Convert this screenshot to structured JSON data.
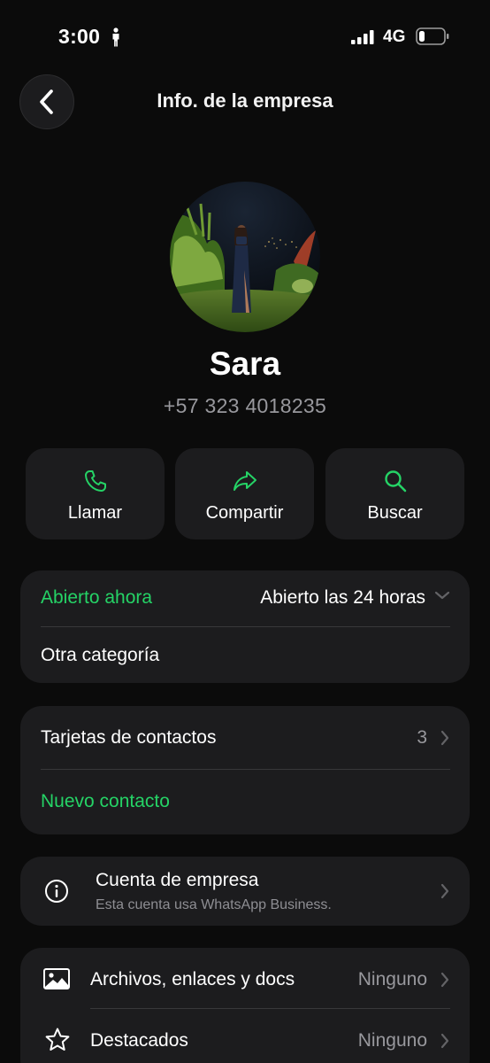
{
  "status_bar": {
    "time": "3:00",
    "network": "4G",
    "icons": [
      "person-walking-icon",
      "signal-bars-icon",
      "battery-low-icon"
    ]
  },
  "nav": {
    "title": "Info. de la empresa",
    "back_icon": "chevron-left-icon"
  },
  "profile": {
    "name": "Sara",
    "phone": "+57 323 4018235"
  },
  "actions": [
    {
      "label": "Llamar",
      "icon": "phone-icon"
    },
    {
      "label": "Compartir",
      "icon": "share-arrow-icon"
    },
    {
      "label": "Buscar",
      "icon": "search-icon"
    }
  ],
  "hours_card": {
    "status": "Abierto ahora",
    "hours": "Abierto las 24 horas",
    "category": "Otra categoría"
  },
  "contacts_card": {
    "label": "Tarjetas de contactos",
    "count": "3",
    "new_contact": "Nuevo contacto"
  },
  "business_card": {
    "title": "Cuenta de empresa",
    "subtitle": "Esta cuenta usa WhatsApp Business.",
    "icon": "info-circle-icon"
  },
  "media_card": {
    "items": [
      {
        "label": "Archivos, enlaces y docs",
        "value": "Ninguno",
        "icon": "image-icon"
      },
      {
        "label": "Destacados",
        "value": "Ninguno",
        "icon": "star-icon"
      }
    ]
  },
  "colors": {
    "accent": "#25d366",
    "background": "#0b0b0b",
    "card": "#1c1c1e",
    "secondary_text": "#98989d"
  }
}
